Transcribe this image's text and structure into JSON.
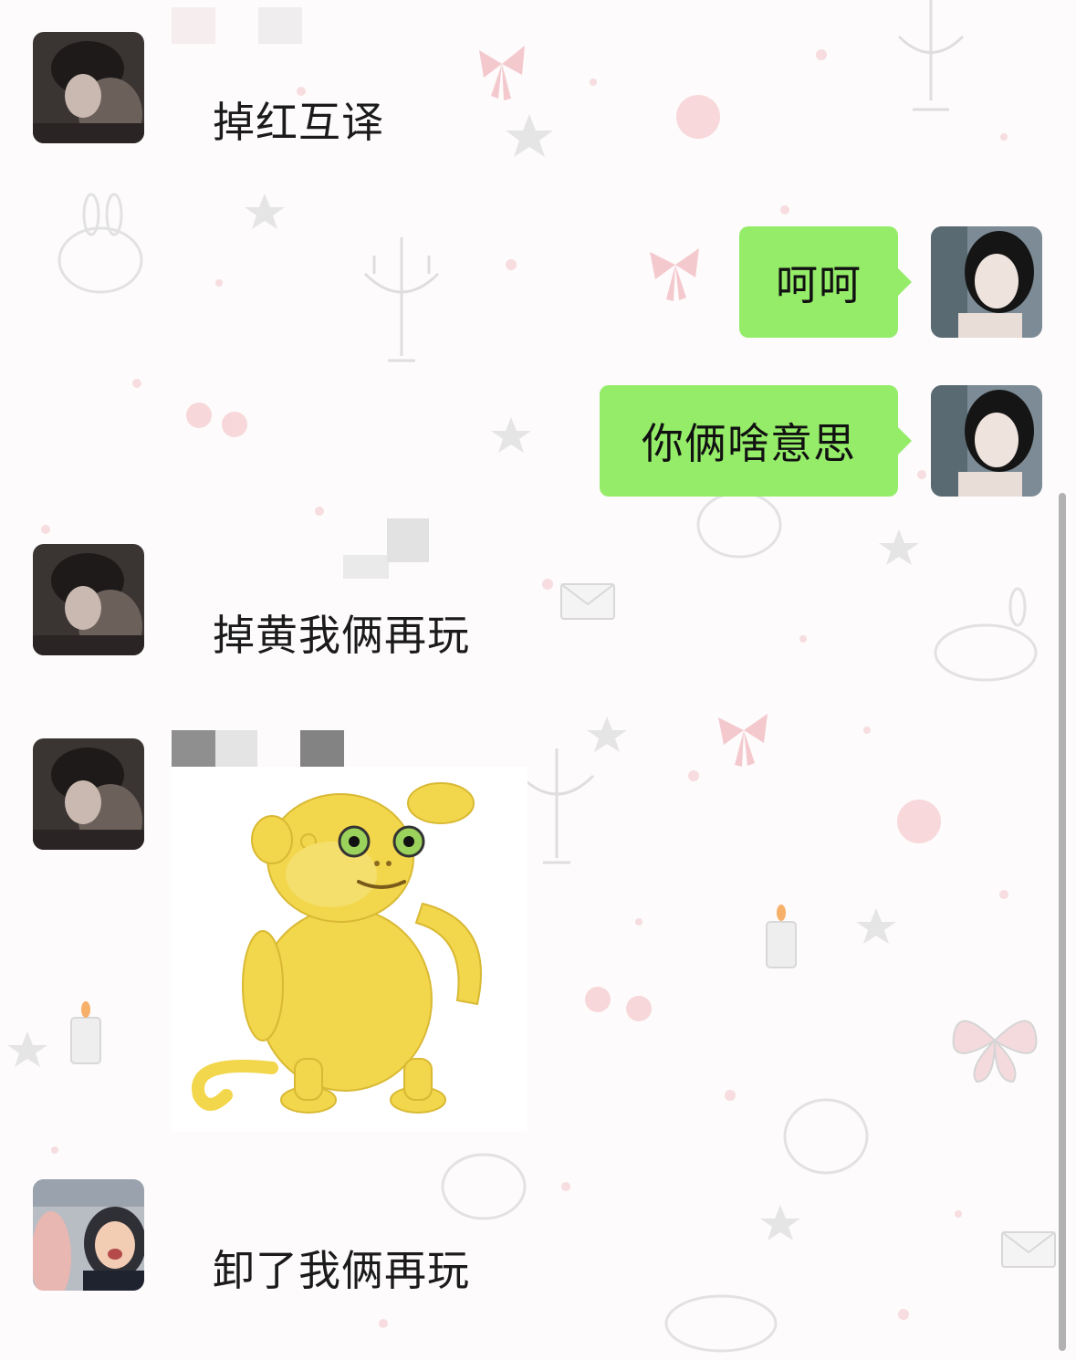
{
  "messages": [
    {
      "side": "left",
      "sender": "friend",
      "text": "掉红互译"
    },
    {
      "side": "right",
      "sender": "me",
      "text": "呵呵"
    },
    {
      "side": "right",
      "sender": "me",
      "text": "你俩啥意思"
    },
    {
      "side": "left",
      "sender": "friend",
      "text": "掉黄我俩再玩"
    },
    {
      "side": "left",
      "sender": "friend",
      "type": "sticker",
      "sticker": "yellow-monkey-scratching-head"
    },
    {
      "side": "left",
      "sender": "friend2",
      "text": "卸了我俩再玩"
    }
  ],
  "colors": {
    "outgoing_bubble": "#95ec69",
    "text": "#1b1b1b",
    "monkey": "#f2d64b"
  }
}
